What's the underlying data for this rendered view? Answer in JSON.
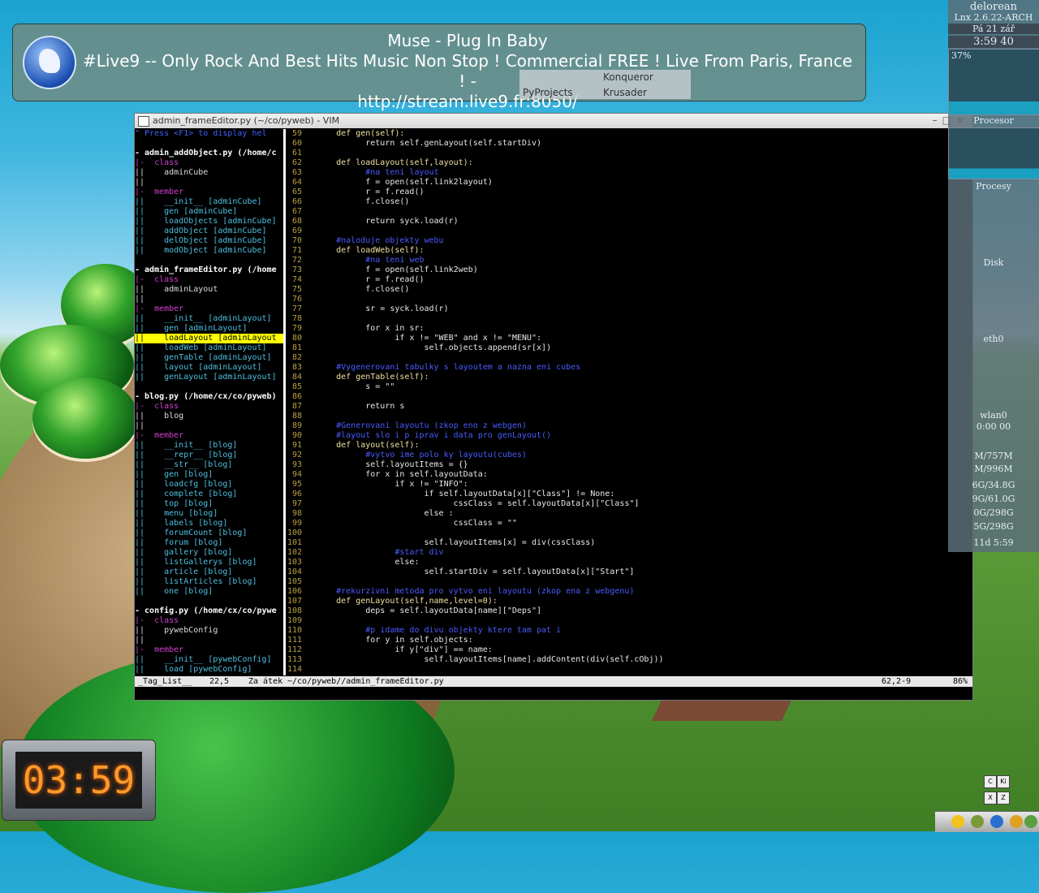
{
  "notification": {
    "line1": "Muse - Plug In Baby",
    "line2": "#Live9 -- Only Rock And Best Hits Music Non Stop ! Commercial FREE ! Live From Paris, France ! -",
    "line3": "http://stream.live9.fr:8050/"
  },
  "menu_peek": {
    "item1": "Konqueror",
    "item2": "PyProjects",
    "item3": "Krusader"
  },
  "vim": {
    "title": "admin_frameEditor.py (~/co/pyweb) - VIM",
    "taglist": [
      "\" Press <F1> to display hel",
      "",
      "- admin_addObject.py (/home/c",
      "|-  class",
      "||    adminCube",
      "||",
      "|-  member",
      "||    __init__ [adminCube]",
      "||    gen [adminCube]",
      "||    loadObjects [adminCube]",
      "||    addObject [adminCube]",
      "||    delObject [adminCube]",
      "||    modObject [adminCube]",
      "",
      "- admin_frameEditor.py (/home",
      "|-  class",
      "||    adminLayout",
      "||",
      "|-  member",
      "||    __init__ [adminLayout]",
      "||    gen [adminLayout]",
      "||    loadLayout [adminLayout",
      "||    loadWeb [adminLayout]",
      "||    genTable [adminLayout]",
      "||    layout [adminLayout]",
      "||    genLayout [adminLayout]",
      "",
      "- blog.py (/home/cx/co/pyweb)",
      "|-  class",
      "||    blog",
      "||",
      "|-  member",
      "||    __init__ [blog]",
      "||    __repr__ [blog]",
      "||    __str__ [blog]",
      "||    gen [blog]",
      "||    loadcfg [blog]",
      "||    complete [blog]",
      "||    top [blog]",
      "||    menu [blog]",
      "||    labels [blog]",
      "||    forumCount [blog]",
      "||    forum [blog]",
      "||    gallery [blog]",
      "||    listGallerys [blog]",
      "||    article [blog]",
      "||    listArticles [blog]",
      "||    one [blog]",
      "",
      "- config.py (/home/cx/co/pywe",
      "|-  class",
      "||    pywebConfig",
      "||",
      "|-  member",
      "||    __init__ [pywebConfig]",
      "||    load [pywebConfig]"
    ],
    "line_numbers": [
      "59",
      "60",
      "61",
      "62",
      "63",
      "64",
      "65",
      "66",
      "67",
      "68",
      "69",
      "70",
      "71",
      "72",
      "73",
      "74",
      "75",
      "76",
      "77",
      "78",
      "79",
      "80",
      "81",
      "82",
      "83",
      "84",
      "85",
      "86",
      "87",
      "88",
      "89",
      "90",
      "91",
      "92",
      "93",
      "94",
      "95",
      "96",
      "97",
      "98",
      "99",
      "100",
      "101",
      "102",
      "103",
      "104",
      "105",
      "106",
      "107",
      "108",
      "109",
      "110",
      "111",
      "112",
      "113",
      "114"
    ],
    "code": [
      "\tdef gen(self):",
      "\t\treturn self.genLayout(self.startDiv)",
      "",
      "\tdef loadLayout(self,layout):",
      "\t\t#na teni layout",
      "\t\tf = open(self.link2layout)",
      "\t\tr = f.read()",
      "\t\tf.close()",
      "",
      "\t\treturn syck.load(r)",
      "",
      "\t#naloduje objekty webu",
      "\tdef loadWeb(self):",
      "\t\t#na teni web",
      "\t\tf = open(self.link2web)",
      "\t\tr = f.read()",
      "\t\tf.close()",
      "",
      "\t\tsr = syck.load(r)",
      "",
      "\t\tfor x in sr:",
      "\t\t\tif x != \"WEB\" and x != \"MENU\":",
      "\t\t\t\tself.objects.append(sr[x])",
      "",
      "\t#Vygenerovani tabulky s layoutem a nazna eni cubes",
      "\tdef genTable(self):",
      "\t\ts = \"\"",
      "",
      "\t\treturn s",
      "",
      "\t#Generovani layoutu (zkop eno z webgen)",
      "\t#layout slo i p iprav i data pro genLayout()",
      "\tdef layout(self):",
      "\t\t#vytvo ime polo ky layoutu(cubes)",
      "\t\tself.layoutItems = {}",
      "\t\tfor x in self.layoutData:",
      "\t\t\tif x != \"INFO\":",
      "\t\t\t\tif self.layoutData[x][\"Class\"] != None:",
      "\t\t\t\t\tcssClass = self.layoutData[x][\"Class\"]",
      "\t\t\t\telse :",
      "\t\t\t\t\tcssClass = \"\"",
      "",
      "\t\t\t\tself.layoutItems[x] = div(cssClass)",
      "\t\t\t#start div",
      "\t\t\telse:",
      "\t\t\t\tself.startDiv = self.layoutData[x][\"Start\"]",
      "",
      "\t#rekurzivni metoda pro vytvo eni layoutu (zkop ena z webgenu)",
      "\tdef genLayout(self,name,level=0):",
      "\t\tdeps = self.layoutData[name][\"Deps\"]",
      "",
      "\t\t#p idame do divu objekty ktere tam pat i",
      "\t\tfor y in self.objects:",
      "\t\t\tif y[\"div\"] == name:",
      "\t\t\t\tself.layoutItems[name].addContent(div(self.cObj))",
      ""
    ],
    "status": {
      "tag_list": "_Tag_List__",
      "pos_left": "22,5",
      "za_atek": "Za átek",
      "file": "~/co/pyweb//admin_frameEditor.py",
      "pos_right": "62,2-9",
      "percent": "86%"
    }
  },
  "conky": {
    "host": "delorean",
    "kernel": "Lnx 2.6.22-ARCH",
    "date": "Pá 21 zář",
    "time": "3:59 40",
    "cpu_pct": "37%",
    "procesor": "Procesor",
    "procesy": "Procesy",
    "disk": "Disk",
    "eth0": "eth0",
    "wlan0": "wlan0",
    "wlan_time": "0:00 00",
    "mem1": "M/757M",
    "mem2": "M/996M",
    "disk1": "6G/34.8G",
    "disk2": "9G/61.0G",
    "disk3": "0G/298G",
    "disk4": "5G/298G",
    "uptime": "11d 5:59"
  },
  "clock": {
    "time": "03:59"
  },
  "pager": {
    "c": "C",
    "ki": "Ki",
    "x": "X",
    "z": "Z"
  }
}
